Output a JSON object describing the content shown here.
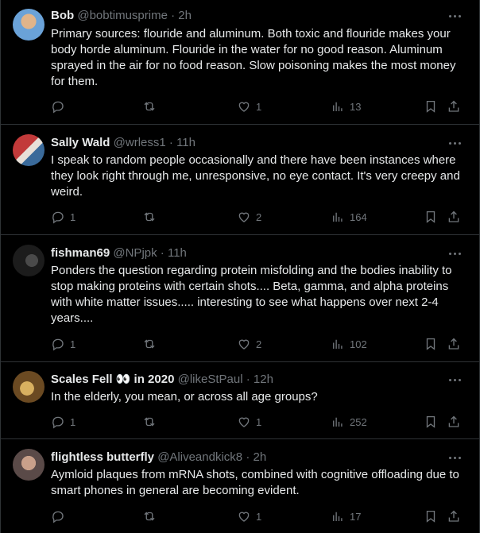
{
  "posts": [
    {
      "name": "Bob",
      "handle": "@bobtimusprime",
      "time": "2h",
      "text": "Primary sources: flouride and aluminum.  Both toxic and flouride makes your body horde aluminum.  Flouride in the water for no good reason.  Aluminum sprayed in the air for no food reason.   Slow poisoning makes the most money for them.",
      "replies": "",
      "reposts": "",
      "likes": "1",
      "views": "13"
    },
    {
      "name": "Sally Wald",
      "handle": "@wrless1",
      "time": "11h",
      "text": "I speak to random people occasionally and there have been instances where they look right through me, unresponsive, no eye contact.    It's very creepy and weird.",
      "replies": "1",
      "reposts": "",
      "likes": "2",
      "views": "164"
    },
    {
      "name": "fishman69",
      "handle": "@NPjpk",
      "time": "11h",
      "text": "Ponders the question regarding protein misfolding and the bodies inability to stop making proteins with certain shots.... Beta, gamma, and alpha proteins with white matter issues..... interesting to see what happens over next 2-4 years....",
      "replies": "1",
      "reposts": "",
      "likes": "2",
      "views": "102"
    },
    {
      "name": "Scales Fell 👀 in 2020",
      "handle": "@likeStPaul",
      "time": "12h",
      "text": "In the elderly, you mean, or across all age groups?",
      "replies": "1",
      "reposts": "",
      "likes": "1",
      "views": "252"
    },
    {
      "name": "flightless butterfly",
      "handle": "@Aliveandkick8",
      "time": "2h",
      "text": "Aymloid plaques from mRNA shots, combined with cognitive offloading due to smart phones in general are becoming evident.",
      "replies": "",
      "reposts": "",
      "likes": "1",
      "views": "17"
    }
  ],
  "separator": "·",
  "icons": {
    "reply": "reply-icon",
    "repost": "repost-icon",
    "like": "heart-icon",
    "views": "views-icon",
    "bookmark": "bookmark-icon",
    "share": "share-icon",
    "more": "more-icon"
  },
  "colors": {
    "background": "#000000",
    "text": "#e7e9ea",
    "secondary": "#71767b",
    "border": "#2f3336"
  }
}
